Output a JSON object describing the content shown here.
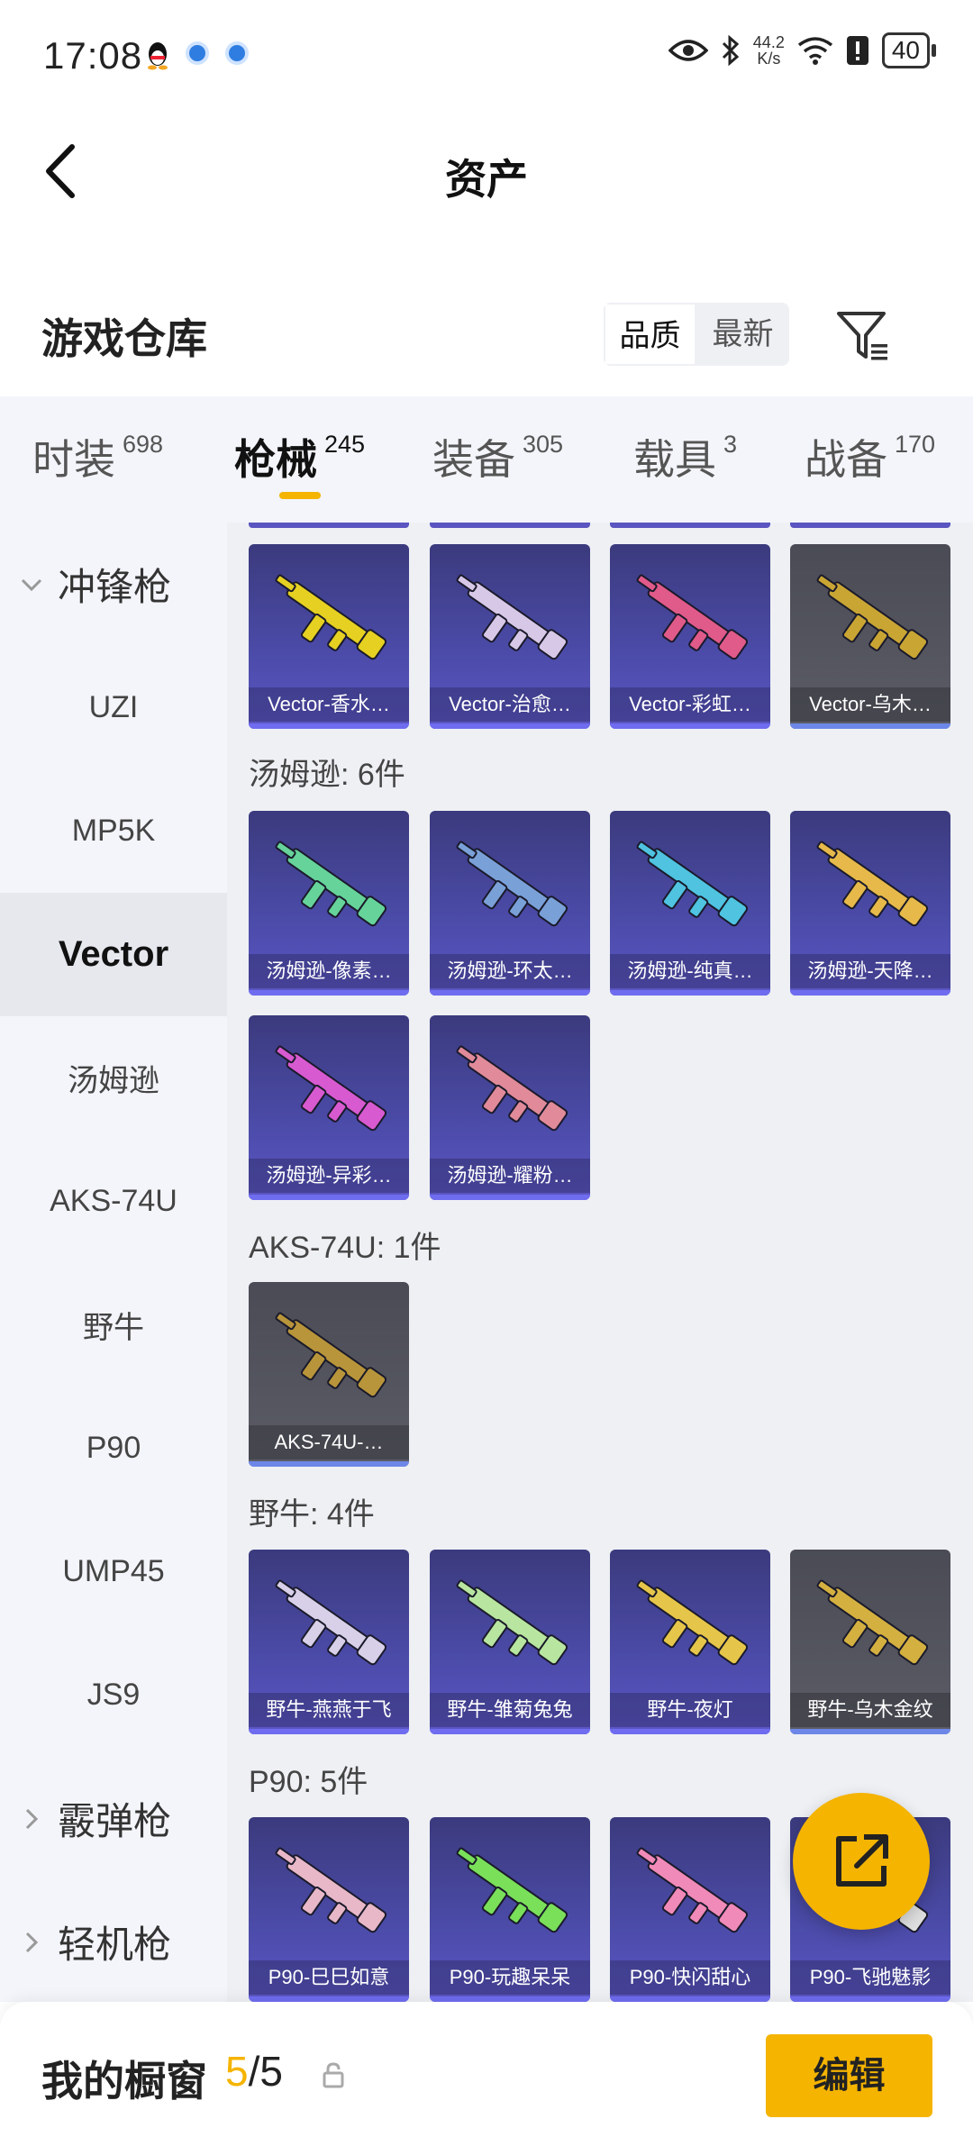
{
  "status_bar": {
    "time": "17:08",
    "speed_value": "44.2",
    "speed_unit": "K/s",
    "battery": "40"
  },
  "header": {
    "title": "资产"
  },
  "warehouse": {
    "title": "游戏仓库",
    "sort_options": [
      "品质",
      "最新"
    ],
    "active_sort": "品质"
  },
  "tabs": [
    {
      "label": "时装",
      "count": "698"
    },
    {
      "label": "枪械",
      "count": "245"
    },
    {
      "label": "装备",
      "count": "305"
    },
    {
      "label": "载具",
      "count": "3"
    },
    {
      "label": "战备",
      "count": "170"
    }
  ],
  "active_tab": "枪械",
  "sidebar": {
    "items": [
      {
        "label": "冲锋枪",
        "type": "group-expanded"
      },
      {
        "label": "UZI"
      },
      {
        "label": "MP5K"
      },
      {
        "label": "Vector",
        "active": true
      },
      {
        "label": "汤姆逊"
      },
      {
        "label": "AKS-74U"
      },
      {
        "label": "野牛"
      },
      {
        "label": "P90"
      },
      {
        "label": "UMP45"
      },
      {
        "label": "JS9"
      },
      {
        "label": "霰弹枪",
        "type": "group-collapsed"
      },
      {
        "label": "轻机枪",
        "type": "group-collapsed"
      }
    ]
  },
  "sections": [
    {
      "label": "",
      "items": [
        {
          "name": "Vector-香水…",
          "quality": "purple",
          "color": "#e6d021"
        },
        {
          "name": "Vector-治愈…",
          "quality": "purple",
          "color": "#d8c8e8"
        },
        {
          "name": "Vector-彩虹…",
          "quality": "purple",
          "color": "#e05a8a"
        },
        {
          "name": "Vector-乌木…",
          "quality": "gray",
          "color": "#c9a534"
        }
      ]
    },
    {
      "label": "汤姆逊: 6件",
      "items": [
        {
          "name": "汤姆逊-像素…",
          "quality": "purple",
          "color": "#66d39a"
        },
        {
          "name": "汤姆逊-环太…",
          "quality": "purple",
          "color": "#7aa0d8"
        },
        {
          "name": "汤姆逊-纯真…",
          "quality": "purple",
          "color": "#4fc3e0"
        },
        {
          "name": "汤姆逊-天降…",
          "quality": "purple",
          "color": "#e6b94a"
        },
        {
          "name": "汤姆逊-异彩…",
          "quality": "purple",
          "color": "#d85ad0"
        },
        {
          "name": "汤姆逊-耀粉…",
          "quality": "purple",
          "color": "#e08a9a"
        }
      ]
    },
    {
      "label": "AKS-74U: 1件",
      "items": [
        {
          "name": "AKS-74U-…",
          "quality": "gray",
          "color": "#b8953a"
        }
      ]
    },
    {
      "label": "野牛: 4件",
      "items": [
        {
          "name": "野牛-燕燕于飞",
          "quality": "purple",
          "color": "#d8d0e8"
        },
        {
          "name": "野牛-雏菊兔兔",
          "quality": "purple",
          "color": "#b8e6a0"
        },
        {
          "name": "野牛-夜灯",
          "quality": "purple",
          "color": "#e6c64a"
        },
        {
          "name": "野牛-乌木金纹",
          "quality": "gray",
          "color": "#d4b040"
        }
      ]
    },
    {
      "label": "P90: 5件",
      "items": [
        {
          "name": "P90-巳巳如意",
          "quality": "purple",
          "color": "#e8b8c8"
        },
        {
          "name": "P90-玩趣呆呆",
          "quality": "purple",
          "color": "#7ae05a"
        },
        {
          "name": "P90-快闪甜心",
          "quality": "purple",
          "color": "#f08ab8"
        },
        {
          "name": "P90-飞驰魅影",
          "quality": "purple",
          "color": "#e0e0e0"
        }
      ]
    }
  ],
  "showcase": {
    "title": "我的橱窗",
    "current": "5",
    "separator": "/",
    "total": "5",
    "edit_label": "编辑"
  },
  "colors": {
    "accent": "#f5b400",
    "card_purple": "#4a4aa6",
    "card_gray": "#5b5c66",
    "panel_bg": "#eef0f4"
  }
}
